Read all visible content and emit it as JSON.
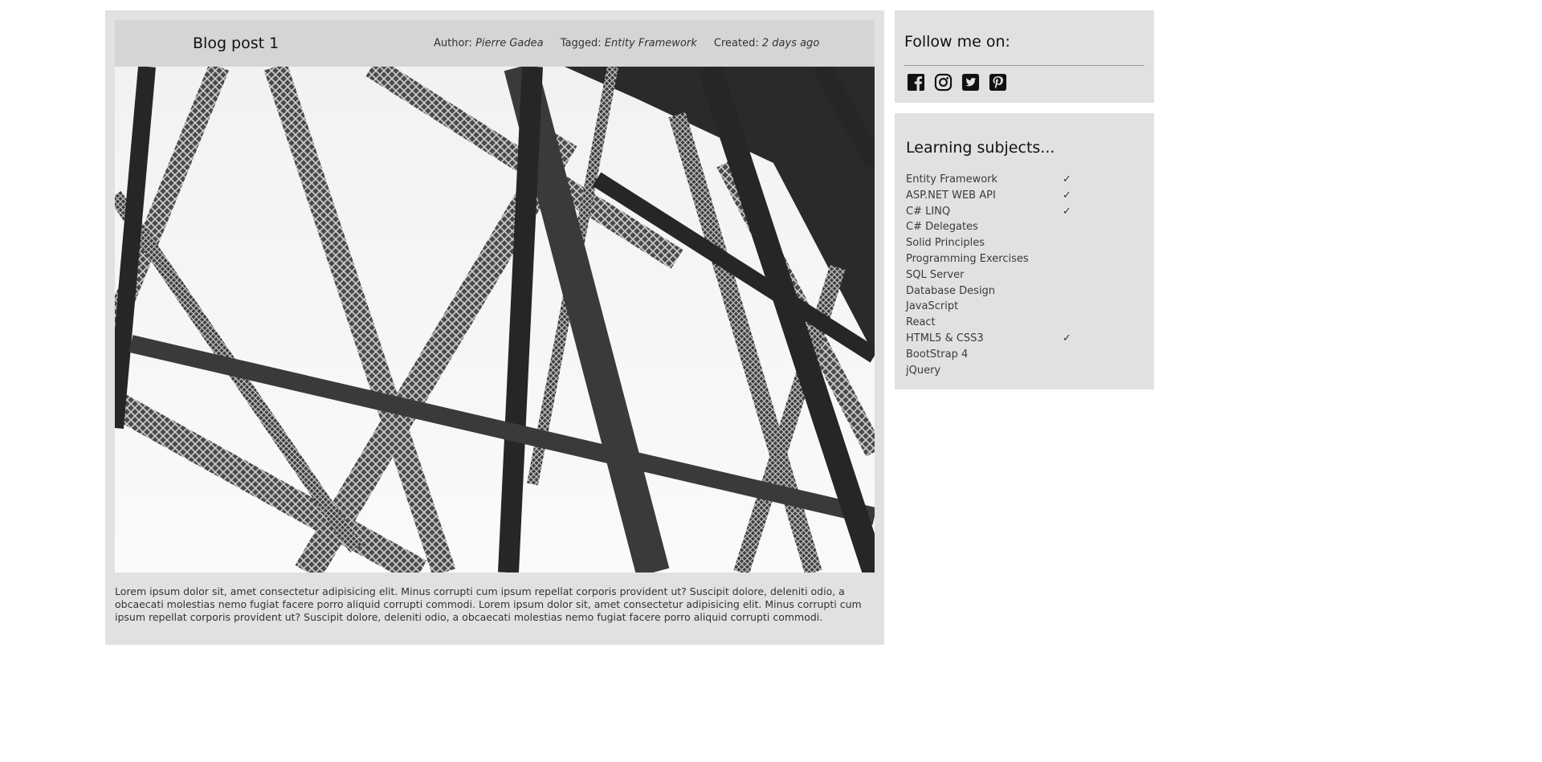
{
  "post": {
    "title": "Blog post 1",
    "meta": {
      "author_label": "Author:",
      "author": "Pierre Gadea",
      "tagged_label": "Tagged:",
      "tag": "Entity Framework",
      "created_label": "Created:",
      "created": "2 days ago"
    },
    "image_subject": "steel-truss-bridge-photo",
    "body": "Lorem ipsum dolor sit, amet consectetur adipisicing elit. Minus corrupti cum ipsum repellat corporis provident ut? Suscipit dolore, deleniti odio, a obcaecati molestias nemo fugiat facere porro aliquid corrupti commodi. Lorem ipsum dolor sit, amet consectetur adipisicing elit. Minus corrupti cum ipsum repellat corporis provident ut? Suscipit dolore, deleniti odio, a obcaecati molestias nemo fugiat facere porro aliquid corrupti commodi."
  },
  "follow": {
    "title": "Follow me on:",
    "icons": [
      "facebook-icon",
      "instagram-icon",
      "twitter-icon",
      "pinterest-icon"
    ]
  },
  "learning": {
    "title": "Learning subjects...",
    "check_mark": "✓",
    "subjects": [
      {
        "label": "Entity Framework",
        "done": true
      },
      {
        "label": "ASP.NET WEB API",
        "done": true
      },
      {
        "label": "C# LINQ",
        "done": true
      },
      {
        "label": "C# Delegates",
        "done": false
      },
      {
        "label": "Solid Principles",
        "done": false
      },
      {
        "label": "Programming Exercises",
        "done": false
      },
      {
        "label": "SQL Server",
        "done": false
      },
      {
        "label": "Database Design",
        "done": false
      },
      {
        "label": "JavaScript",
        "done": false
      },
      {
        "label": "React",
        "done": false
      },
      {
        "label": "HTML5 & CSS3",
        "done": true
      },
      {
        "label": "BootStrap 4",
        "done": false
      },
      {
        "label": "jQuery",
        "done": false
      }
    ]
  },
  "colors": {
    "card_background": "#e1e1e1",
    "header_background": "#d5d5d5",
    "icon_color": "#111111"
  }
}
